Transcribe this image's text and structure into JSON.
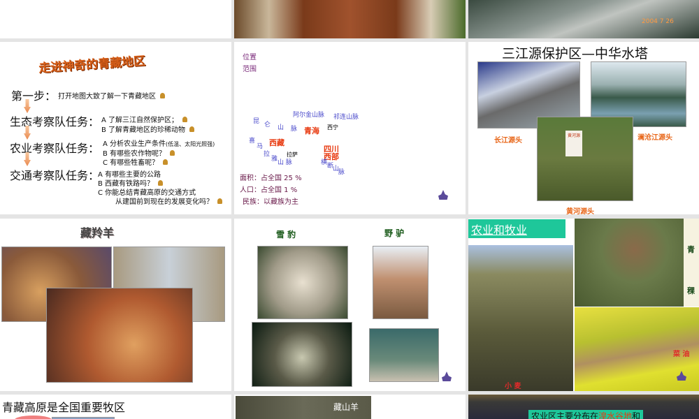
{
  "slide2": {
    "title": "走进神奇的青藏地区",
    "step1_label": "第一步：",
    "step1_text": "打开地图大致了解一下青藏地区",
    "eco_label": "生态考察队任务：",
    "eco_a": "A  了解三江自然保护区；",
    "eco_b": "B  了解青藏地区的珍稀动物",
    "agri_label": "农业考察队任务：",
    "agri_a": "A  分析农业生产条件",
    "agri_a_note": "(低温、太阳光照强)",
    "agri_b": "B  有哪些农作物呢？",
    "agri_c": "C  有哪些牲畜呢？",
    "trans_label": "交通考察队任务：",
    "trans_a": "A  有哪些主要的公路",
    "trans_b": "B  西藏有铁路吗？",
    "trans_c": "C  你能总结青藏高原的交通方式",
    "trans_c2": "从建国前到现在的发展变化吗？"
  },
  "slide3": {
    "position": "位置",
    "range": "范围",
    "kunlun": [
      "昆",
      "仑",
      "山",
      "脉"
    ],
    "aerjin": "阿尔金山脉",
    "qilian": "祁连山脉",
    "qinghai": "青海",
    "xining": "西宁",
    "xizang": "西藏",
    "himalaya": [
      "喜",
      "马",
      "拉",
      "雅",
      "山 脉"
    ],
    "lhasa": "拉萨",
    "sichuan1": "四川",
    "sichuan2": "西部",
    "hengduan": [
      "横",
      "断",
      "山",
      "脉"
    ],
    "area": "面积：占全国 25 %",
    "population": "人口：占全国 1 %",
    "ethnic": "民族：以藏族为主"
  },
  "slide4": {
    "title": "三江源保护区—中华水塔",
    "changjiang": "长江源头",
    "lancang": "澜沧江源头",
    "huanghe": "黄河源头",
    "sign": "黄河源"
  },
  "slide5": {
    "title": "藏羚羊"
  },
  "slide6": {
    "snow_leopard": "雪  豹",
    "wild_donkey": "野  驴"
  },
  "slide7": {
    "title": "农业和牧业",
    "wheat": "小  麦",
    "barley1": "青",
    "barley2": "稞",
    "rapeseed": "菜  油"
  },
  "slide_top3": {
    "date": "2004  7  26"
  },
  "slide8": {
    "title": "青藏高原是全国重要牧区"
  },
  "slide9": {
    "caption": "藏山羊"
  },
  "slide10": {
    "text_a": "农业区主要分布在",
    "text_b": "湟水谷地",
    "text_c": "和"
  }
}
